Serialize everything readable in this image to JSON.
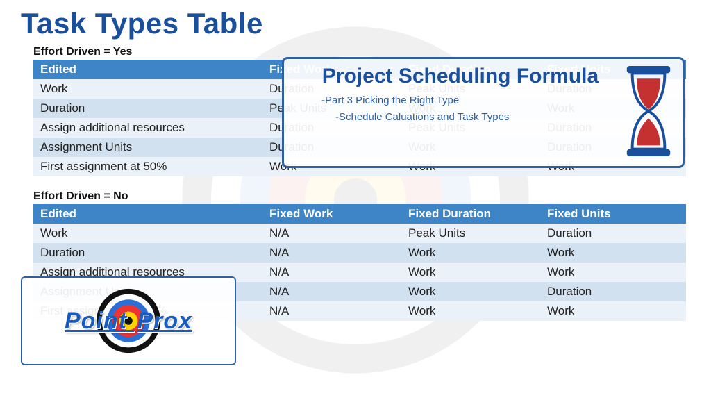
{
  "title": "Task Types Table",
  "table_yes": {
    "caption": "Effort Driven = Yes",
    "headers": [
      "Edited",
      "Fixed Work",
      "Fixed Duration",
      "Fixed Units"
    ],
    "rows": [
      [
        "Work",
        "Duration",
        "Peak Units",
        "Duration"
      ],
      [
        "Duration",
        "Peak Units",
        "Work",
        "Work"
      ],
      [
        "Assign additional resources",
        "Duration",
        "Peak Units",
        "Duration"
      ],
      [
        "Assignment Units",
        "Duration",
        "Work",
        "Duration"
      ],
      [
        "First assignment at 50%",
        "Work",
        "Work",
        "Work"
      ]
    ]
  },
  "table_no": {
    "caption": "Effort Driven = No",
    "headers": [
      "Edited",
      "Fixed Work",
      "Fixed Duration",
      "Fixed Units"
    ],
    "rows": [
      [
        "Work",
        "N/A",
        "Peak Units",
        "Duration"
      ],
      [
        "Duration",
        "N/A",
        "Work",
        "Work"
      ],
      [
        "Assign additional resources",
        "N/A",
        "Work",
        "Work"
      ],
      [
        "Assignment Units",
        "N/A",
        "Work",
        "Duration"
      ],
      [
        "First assignment at 50%",
        "N/A",
        "Work",
        "Work"
      ]
    ]
  },
  "card": {
    "title": "Project Scheduling Formula",
    "line1": "-Part 3 Picking the Right Type",
    "line2": "-Schedule Caluations and Task Types"
  },
  "logo": {
    "word1": "Point",
    "word2": "Prox"
  },
  "colors": {
    "brand_blue": "#1a4f9c",
    "header_fill": "#3d85c6",
    "row_odd": "#eaf1f8",
    "row_even": "#d2e1ef"
  }
}
